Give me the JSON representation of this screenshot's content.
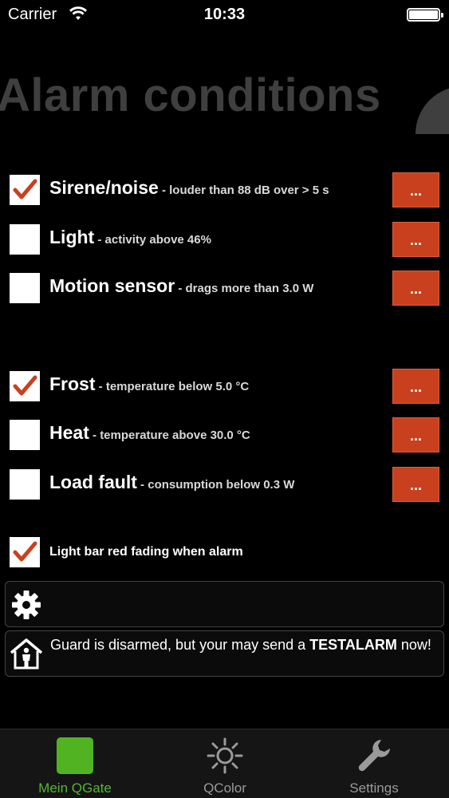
{
  "status_bar": {
    "carrier": "Carrier",
    "time": "10:33"
  },
  "page_title": "Alarm conditions",
  "alarms": [
    {
      "title": "Sirene/noise",
      "desc": " - louder than 88 dB over > 5 s",
      "checked": true,
      "button": "..."
    },
    {
      "title": "Light",
      "desc": " - activity above 46%",
      "checked": false,
      "button": "..."
    },
    {
      "title": "Motion sensor",
      "desc": " - drags more than 3.0 W",
      "checked": false,
      "button": "..."
    },
    {
      "title": "Frost",
      "desc": " - temperature below 5.0 °C",
      "checked": true,
      "button": "..."
    },
    {
      "title": "Heat",
      "desc": " - temperature above 30.0 °C",
      "checked": false,
      "button": "..."
    },
    {
      "title": "Load fault",
      "desc": " - consumption below 0.3 W",
      "checked": false,
      "button": "..."
    }
  ],
  "fading": {
    "label": "Light bar red fading when alarm",
    "checked": true
  },
  "guard": {
    "text_before": "Guard is disarmed, but your may send a ",
    "text_bold": "TESTALARM",
    "text_after": " now!"
  },
  "tabs": [
    {
      "label": "Mein QGate",
      "icon": "green-square-icon",
      "active": true
    },
    {
      "label": "QColor",
      "icon": "sun-icon",
      "active": false
    },
    {
      "label": "Settings",
      "icon": "wrench-icon",
      "active": false
    }
  ],
  "colors": {
    "accent_button": "#c9401e",
    "active_tab": "#57b532",
    "title": "#3f3f3f"
  }
}
